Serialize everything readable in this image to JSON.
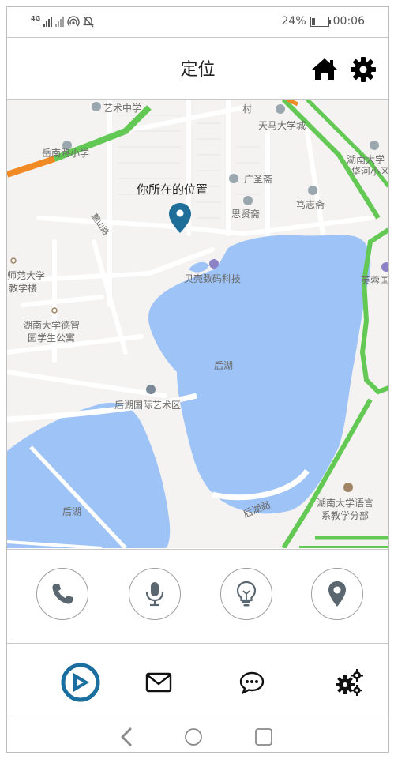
{
  "status_bar": {
    "network": "4G",
    "battery": "24%",
    "battery_level": 0.24,
    "time": "00:06"
  },
  "header": {
    "title": "定位",
    "home_icon": "home-icon",
    "settings_icon": "gear-icon"
  },
  "map": {
    "marker_label": "你所在的位置",
    "places": {
      "yishu_zhongxue": "艺术中学",
      "yuenan_xiaoxue": "岳南路小学",
      "cun": "村",
      "tianma": "天马大学城",
      "hunan_daxue_poshan": "湖南大学",
      "hunan_daxue_poshan2": "垡河小区",
      "guangsheng": "广圣斋",
      "sixian": "思贤斋",
      "duzhi": "笃志斋",
      "beike": "贝壳数码科技",
      "shifan": "师范大学",
      "jiaoxuelou": "教学楼",
      "fuhong": "芙蓉国",
      "hunan_dezhi": "湖南大学德智",
      "yuan_gongyu": "园学生公寓",
      "houhu": "后湖",
      "houhu_art": "后湖国际艺术区",
      "houhu2": "后湖",
      "houhu_road": "后湖路",
      "hunan_waiyu": "湖南大学语言",
      "waiyu_fenbu": "系教学分部",
      "lushan_road": "麓山路"
    }
  },
  "actions": [
    {
      "name": "phone-icon"
    },
    {
      "name": "microphone-icon"
    },
    {
      "name": "lightbulb-icon"
    },
    {
      "name": "location-pin-icon"
    }
  ],
  "tabs": [
    {
      "name": "play-icon",
      "active": true
    },
    {
      "name": "mail-icon",
      "active": false
    },
    {
      "name": "chat-icon",
      "active": false
    },
    {
      "name": "gears-icon",
      "active": false
    }
  ],
  "nav": [
    "back-icon",
    "home-circle-icon",
    "recents-icon"
  ],
  "colors": {
    "water": "#9ec3f7",
    "marker": "#1f6e9a",
    "road_green": "#63c954",
    "road_orange": "#f08a24",
    "active_tab": "#1a6fa0",
    "icon_gray": "#5b6770"
  }
}
